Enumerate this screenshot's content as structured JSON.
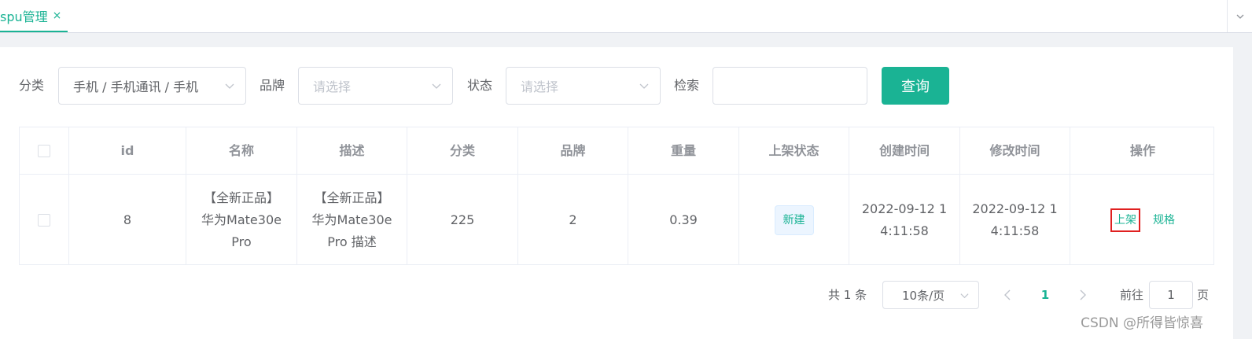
{
  "tabs": [
    {
      "label": "spu管理",
      "close": "×",
      "active": true
    }
  ],
  "tab_dropdown_icon": "chevron-down-icon",
  "filters": {
    "category_label": "分类",
    "category_value": "手机 / 手机通讯 / 手机",
    "brand_label": "品牌",
    "brand_placeholder": "请选择",
    "status_label": "状态",
    "status_placeholder": "请选择",
    "search_label": "检索",
    "search_value": "",
    "query_button": "查询"
  },
  "table": {
    "columns": [
      "id",
      "名称",
      "描述",
      "分类",
      "品牌",
      "重量",
      "上架状态",
      "创建时间",
      "修改时间",
      "操作"
    ],
    "rows": [
      {
        "id": "8",
        "name": "【全新正品】华为Mate30e Pro",
        "desc": "【全新正品】华为Mate30e Pro 描述",
        "category": "225",
        "brand": "2",
        "weight": "0.39",
        "status": "新建",
        "created": "2022-09-12 14:11:58",
        "modified": "2022-09-12 14:11:58",
        "actions": [
          "上架",
          "规格"
        ]
      }
    ]
  },
  "pagination": {
    "total": "共 1 条",
    "page_size": "10条/页",
    "current": "1",
    "goto_label": "前往",
    "goto_value": "1",
    "page_suffix": "页"
  },
  "watermark": "CSDN @所得皆惊喜",
  "colors": {
    "accent": "#1ab394",
    "highlight_box": "#e02020"
  }
}
